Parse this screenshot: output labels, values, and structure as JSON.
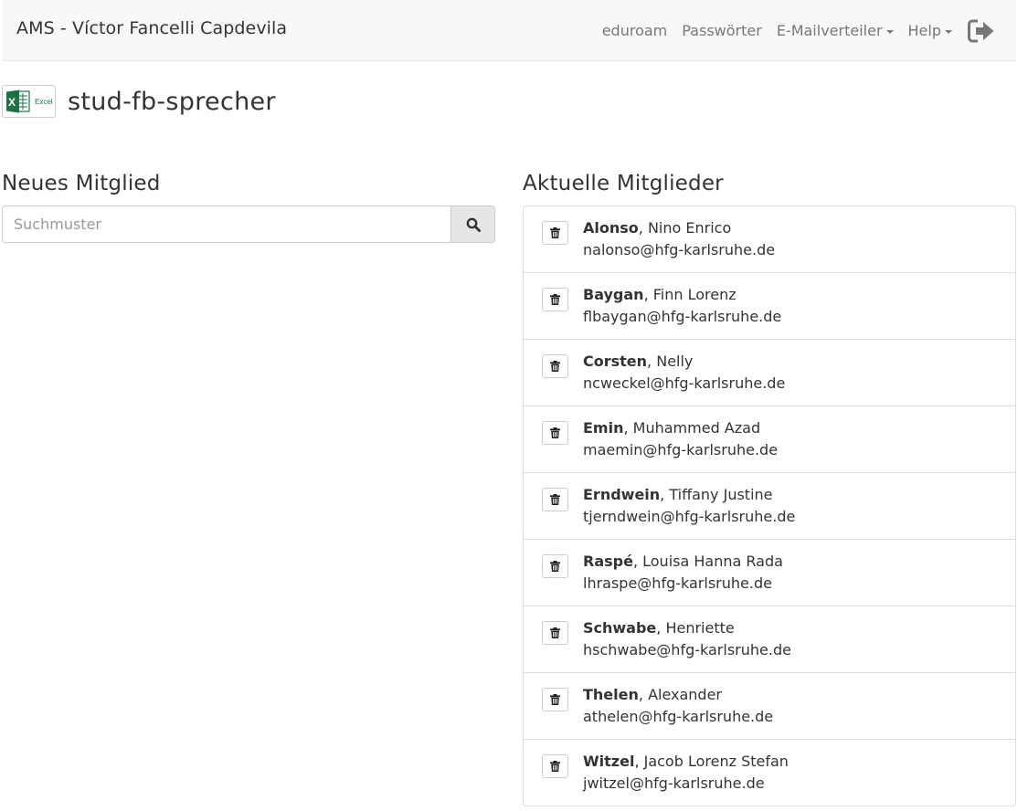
{
  "navbar": {
    "brand": "AMS - Víctor Fancelli Capdevila",
    "links": [
      {
        "label": "eduroam"
      },
      {
        "label": "Passwörter"
      },
      {
        "label": "E-Mailverteiler"
      },
      {
        "label": "Help"
      }
    ],
    "logout_icon": "sign-out-icon"
  },
  "list": {
    "name": "stud-fb-sprecher",
    "excel_label": "Excel"
  },
  "add_section": {
    "title": "Neues Mitglied",
    "search_placeholder": "Suchmuster",
    "search_value": "",
    "search_icon": "search-icon"
  },
  "members_section": {
    "title": "Aktuelle Mitglieder",
    "delete_icon": "trash-icon",
    "members": [
      {
        "last": "Alonso",
        "first": ", Nino Enrico",
        "email": "nalonso@hfg-karlsruhe.de"
      },
      {
        "last": "Baygan",
        "first": ", Finn Lorenz",
        "email": "flbaygan@hfg-karlsruhe.de"
      },
      {
        "last": "Corsten",
        "first": ", Nelly",
        "email": "ncweckel@hfg-karlsruhe.de"
      },
      {
        "last": "Emin",
        "first": ", Muhammed Azad",
        "email": "maemin@hfg-karlsruhe.de"
      },
      {
        "last": "Erndwein",
        "first": ", Tiffany Justine",
        "email": "tjerndwein@hfg-karlsruhe.de"
      },
      {
        "last": "Raspé",
        "first": ", Louisa Hanna Rada",
        "email": "lhraspe@hfg-karlsruhe.de"
      },
      {
        "last": "Schwabe",
        "first": ", Henriette",
        "email": "hschwabe@hfg-karlsruhe.de"
      },
      {
        "last": "Thelen",
        "first": ", Alexander",
        "email": "athelen@hfg-karlsruhe.de"
      },
      {
        "last": "Witzel",
        "first": ", Jacob Lorenz Stefan",
        "email": "jwitzel@hfg-karlsruhe.de"
      }
    ]
  }
}
